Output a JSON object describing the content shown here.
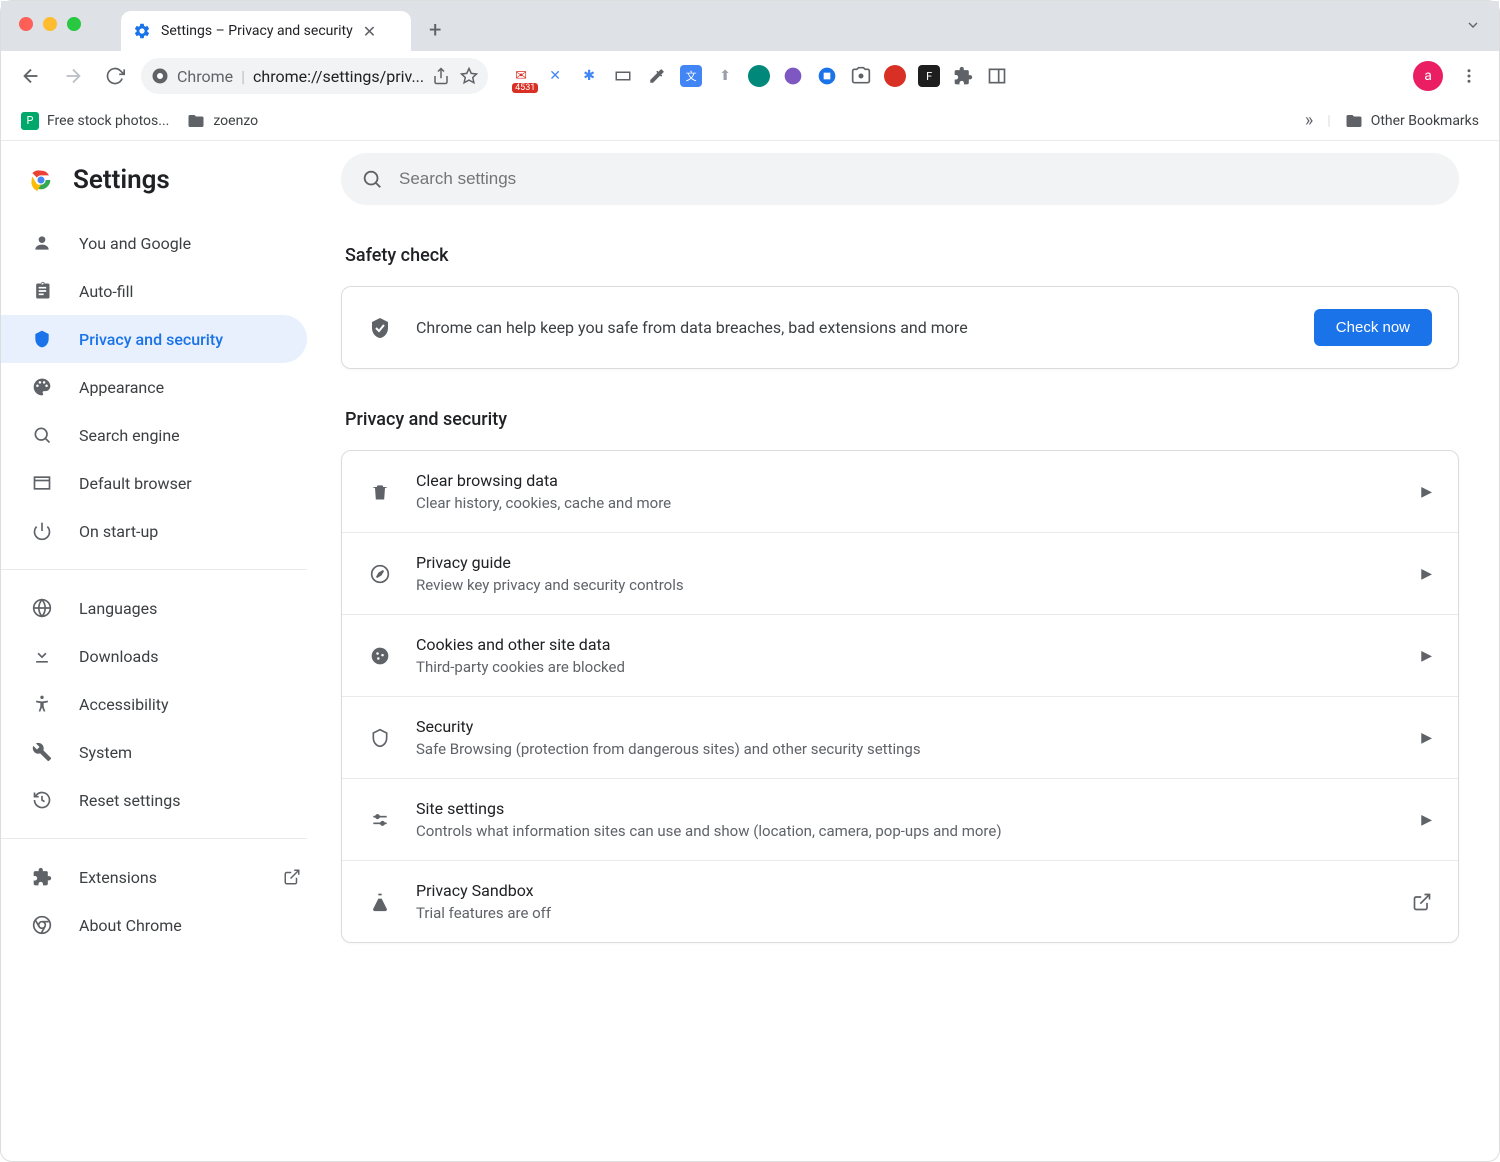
{
  "browser": {
    "tab_title": "Settings – Privacy and security",
    "omnibox_prefix": "Chrome",
    "omnibox_url": "chrome://settings/priv...",
    "gmail_badge": "4531",
    "avatar_letter": "a"
  },
  "bookmarks": {
    "item1": "Free stock photos...",
    "item2": "zoenzo",
    "other": "Other Bookmarks"
  },
  "sidebar": {
    "title": "Settings",
    "items": [
      {
        "label": "You and Google"
      },
      {
        "label": "Auto-fill"
      },
      {
        "label": "Privacy and security"
      },
      {
        "label": "Appearance"
      },
      {
        "label": "Search engine"
      },
      {
        "label": "Default browser"
      },
      {
        "label": "On start-up"
      }
    ],
    "adv": [
      {
        "label": "Languages"
      },
      {
        "label": "Downloads"
      },
      {
        "label": "Accessibility"
      },
      {
        "label": "System"
      },
      {
        "label": "Reset settings"
      }
    ],
    "extensions": "Extensions",
    "about": "About Chrome"
  },
  "search_placeholder": "Search settings",
  "safety": {
    "heading": "Safety check",
    "text": "Chrome can help keep you safe from data breaches, bad extensions and more",
    "button": "Check now"
  },
  "privacy": {
    "heading": "Privacy and security",
    "rows": [
      {
        "title": "Clear browsing data",
        "sub": "Clear history, cookies, cache and more",
        "action": "arrow"
      },
      {
        "title": "Privacy guide",
        "sub": "Review key privacy and security controls",
        "action": "arrow"
      },
      {
        "title": "Cookies and other site data",
        "sub": "Third-party cookies are blocked",
        "action": "arrow"
      },
      {
        "title": "Security",
        "sub": "Safe Browsing (protection from dangerous sites) and other security settings",
        "action": "arrow"
      },
      {
        "title": "Site settings",
        "sub": "Controls what information sites can use and show (location, camera, pop-ups and more)",
        "action": "arrow"
      },
      {
        "title": "Privacy Sandbox",
        "sub": "Trial features are off",
        "action": "external"
      }
    ]
  }
}
